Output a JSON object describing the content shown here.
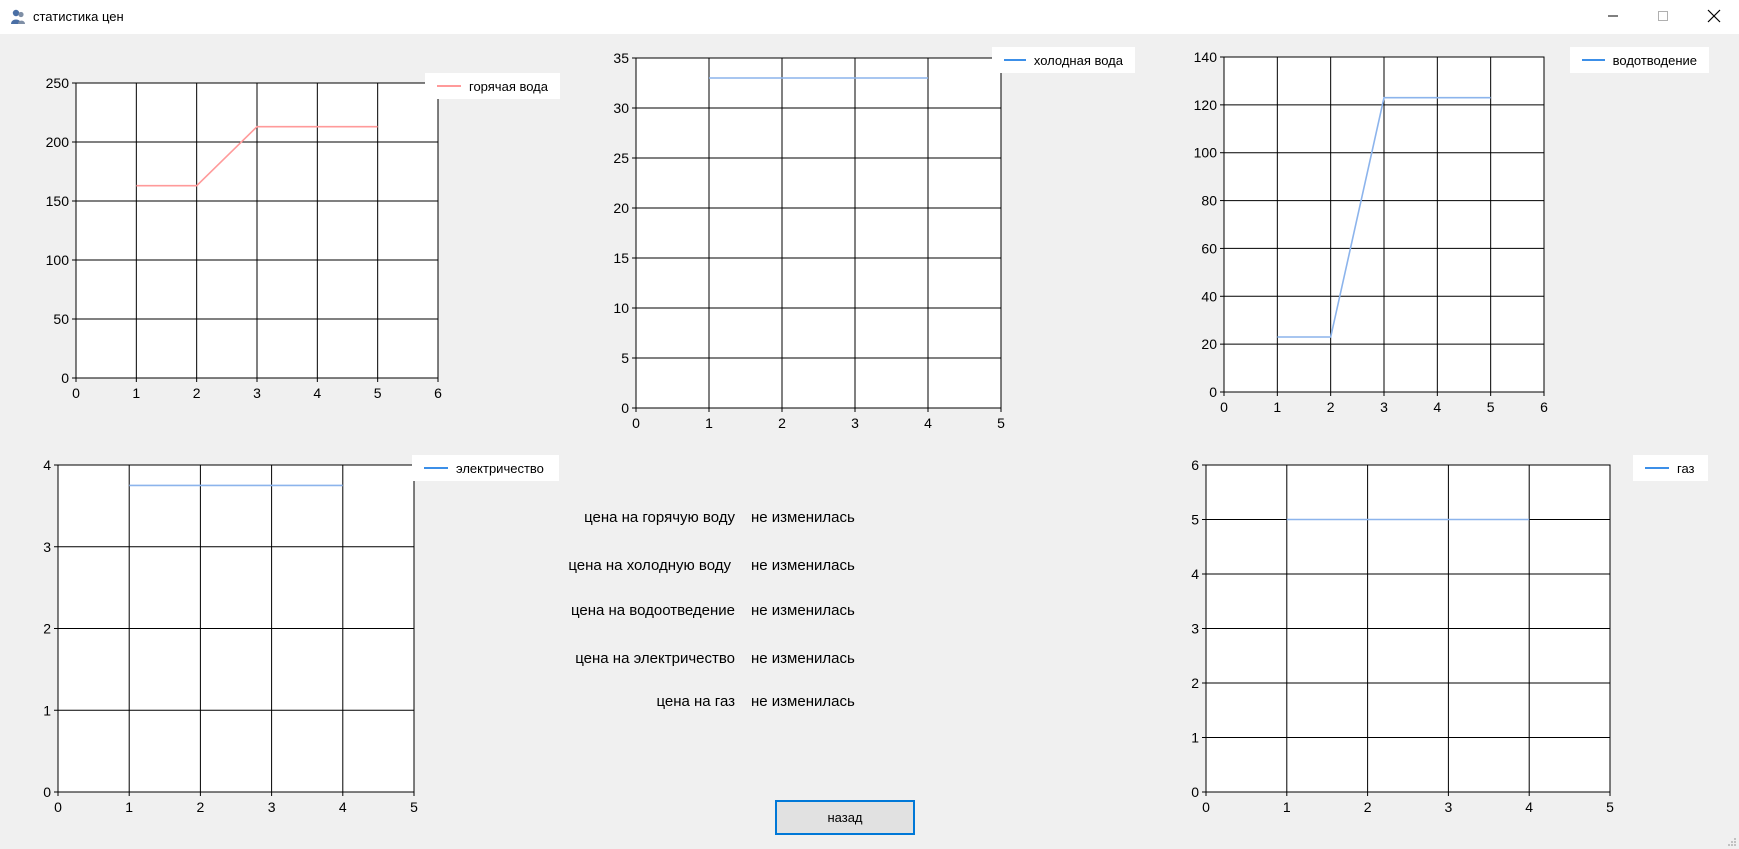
{
  "window": {
    "title": "статистика цен"
  },
  "icons": {
    "app": "app-icon",
    "minimize": "minimize-icon",
    "maximize": "maximize-icon",
    "close": "close-icon"
  },
  "colors": {
    "hot_water": "#ff9a9a",
    "blue_legend": "#3c8fe8",
    "blue_line": "#8cb4ec",
    "grid": "#000000",
    "button_border": "#0078d7"
  },
  "charts": {
    "hot_water": {
      "legend": "горячая вода",
      "chart_data": {
        "type": "line",
        "series": [
          {
            "name": "горячая вода",
            "x": [
              1,
              2,
              3,
              4,
              5
            ],
            "y": [
              163,
              163,
              213,
              213,
              213
            ]
          }
        ],
        "xlim": [
          0,
          6
        ],
        "ylim": [
          0,
          250
        ],
        "xticks": [
          "0",
          "1",
          "2",
          "3",
          "4",
          "5",
          "6"
        ],
        "yticks": [
          "0",
          "50",
          "100",
          "150",
          "200",
          "250"
        ],
        "grid": true,
        "legend": "top-right"
      }
    },
    "cold_water": {
      "legend": "холодная вода",
      "chart_data": {
        "type": "line",
        "series": [
          {
            "name": "холодная вода",
            "x": [
              1,
              2,
              3,
              4
            ],
            "y": [
              33,
              33,
              33,
              33
            ]
          }
        ],
        "xlim": [
          0,
          5
        ],
        "ylim": [
          0,
          35
        ],
        "xticks": [
          "0",
          "1",
          "2",
          "3",
          "4",
          "5"
        ],
        "yticks": [
          "0",
          "5",
          "10",
          "15",
          "20",
          "25",
          "30",
          "35"
        ],
        "grid": true,
        "legend": "top-right"
      }
    },
    "drainage": {
      "legend": "водотводение",
      "chart_data": {
        "type": "line",
        "series": [
          {
            "name": "водотводение",
            "x": [
              1,
              2,
              3,
              4,
              5
            ],
            "y": [
              23,
              23,
              123,
              123,
              123
            ]
          }
        ],
        "xlim": [
          0,
          6
        ],
        "ylim": [
          0,
          140
        ],
        "xticks": [
          "0",
          "1",
          "2",
          "3",
          "4",
          "5",
          "6"
        ],
        "yticks": [
          "0",
          "20",
          "40",
          "60",
          "80",
          "100",
          "120",
          "140"
        ],
        "grid": true,
        "legend": "top-right"
      }
    },
    "electricity": {
      "legend": "электричество",
      "chart_data": {
        "type": "line",
        "series": [
          {
            "name": "электричество",
            "x": [
              1,
              2,
              3,
              4
            ],
            "y": [
              3.75,
              3.75,
              3.75,
              3.75
            ]
          }
        ],
        "xlim": [
          0,
          5
        ],
        "ylim": [
          0,
          4
        ],
        "xticks": [
          "0",
          "1",
          "2",
          "3",
          "4",
          "5"
        ],
        "yticks": [
          "0",
          "1",
          "2",
          "3",
          "4"
        ],
        "grid": true,
        "legend": "top-right"
      }
    },
    "gas": {
      "legend": "газ",
      "chart_data": {
        "type": "line",
        "series": [
          {
            "name": "газ",
            "x": [
              1,
              2,
              3,
              4
            ],
            "y": [
              5,
              5,
              5,
              5
            ]
          }
        ],
        "xlim": [
          0,
          5
        ],
        "ylim": [
          0,
          6
        ],
        "xticks": [
          "0",
          "1",
          "2",
          "3",
          "4",
          "5"
        ],
        "yticks": [
          "0",
          "1",
          "2",
          "3",
          "4",
          "5",
          "6"
        ],
        "grid": true,
        "legend": "top-right"
      }
    }
  },
  "status": [
    {
      "label": "цена на горячую воду",
      "value": "не изменилась"
    },
    {
      "label": "цена на холодную воду",
      "value": "не изменилась"
    },
    {
      "label": "цена на водоотведение",
      "value": "не изменилась"
    },
    {
      "label": "цена на электричество",
      "value": "не изменилась"
    },
    {
      "label": "цена на газ",
      "value": "не изменилась"
    }
  ],
  "buttons": {
    "back": "назад"
  }
}
